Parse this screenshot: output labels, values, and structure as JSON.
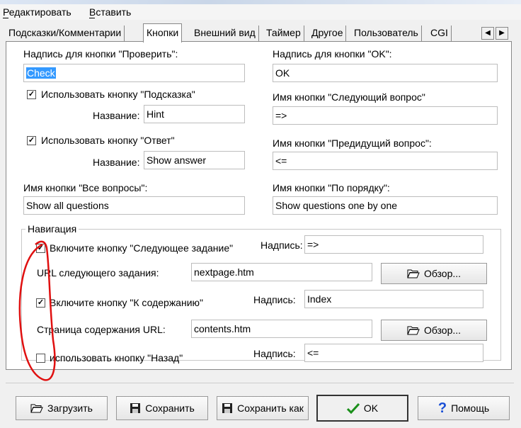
{
  "menu": {
    "items": [
      {
        "label": "Редактировать",
        "hotkey": "Р"
      },
      {
        "label": "Вставить",
        "hotkey": "В"
      }
    ]
  },
  "tabs": [
    {
      "label": "Подсказки/Комментарии"
    },
    {
      "label": "Кнопки",
      "active": true
    },
    {
      "label": "Внешний вид"
    },
    {
      "label": "Таймер"
    },
    {
      "label": "Другое"
    },
    {
      "label": "Пользователь"
    },
    {
      "label": "CGI"
    }
  ],
  "form": {
    "check_label": "Надпись для кнопки \"Проверить\":",
    "check_value": "Check",
    "ok_label": "Надпись для кнопки \"OK\":",
    "ok_value": "OK",
    "use_hint_label": "Использовать кнопку \"Подсказка\"",
    "use_hint_checked": true,
    "hint_name_label": "Название:",
    "hint_name_value": "Hint",
    "next_q_label": "Имя кнопки \"Следующий вопрос\"",
    "next_q_value": "=>",
    "use_answer_label": "Использовать кнопку \"Ответ\"",
    "use_answer_checked": true,
    "answer_name_label": "Название:",
    "answer_name_value": "Show answer",
    "prev_q_label": "Имя кнопки \"Предидущий вопрос\":",
    "prev_q_value": "<=",
    "all_q_label": "Имя кнопки \"Все вопросы\":",
    "all_q_value": "Show all questions",
    "in_order_label": "Имя кнопки \"По порядку\":",
    "in_order_value": "Show questions one by one"
  },
  "navigation": {
    "title": "Навигация",
    "next_task_check_label": "Включите кнопку \"Следующее задание\"",
    "next_task_checked": true,
    "next_task_caption_label": "Надпись:",
    "next_task_caption_value": "=>",
    "next_task_url_label": "URL следующего задания:",
    "next_task_url_value": "nextpage.htm",
    "browse_label": "Обзор...",
    "contents_check_label": "Включите кнопку \"К содержанию\"",
    "contents_checked": true,
    "contents_caption_label": "Надпись:",
    "contents_caption_value": "Index",
    "contents_url_label": "Страница содержания URL:",
    "contents_url_value": "contents.htm",
    "browse2_label": "Обзор...",
    "back_check_label": "использовать кнопку \"Назад\"",
    "back_checked": false,
    "back_caption_label": "Надпись:",
    "back_caption_value": "<="
  },
  "buttons": {
    "load": "Загрузить",
    "save": "Сохранить",
    "save_as": "Сохранить как",
    "ok": "OK",
    "help": "Помощь"
  },
  "colors": {
    "selection": "#3399ff",
    "annotation": "#e01010",
    "help_icon": "#1a4fd6",
    "ok_icon": "#1a8f1a"
  }
}
